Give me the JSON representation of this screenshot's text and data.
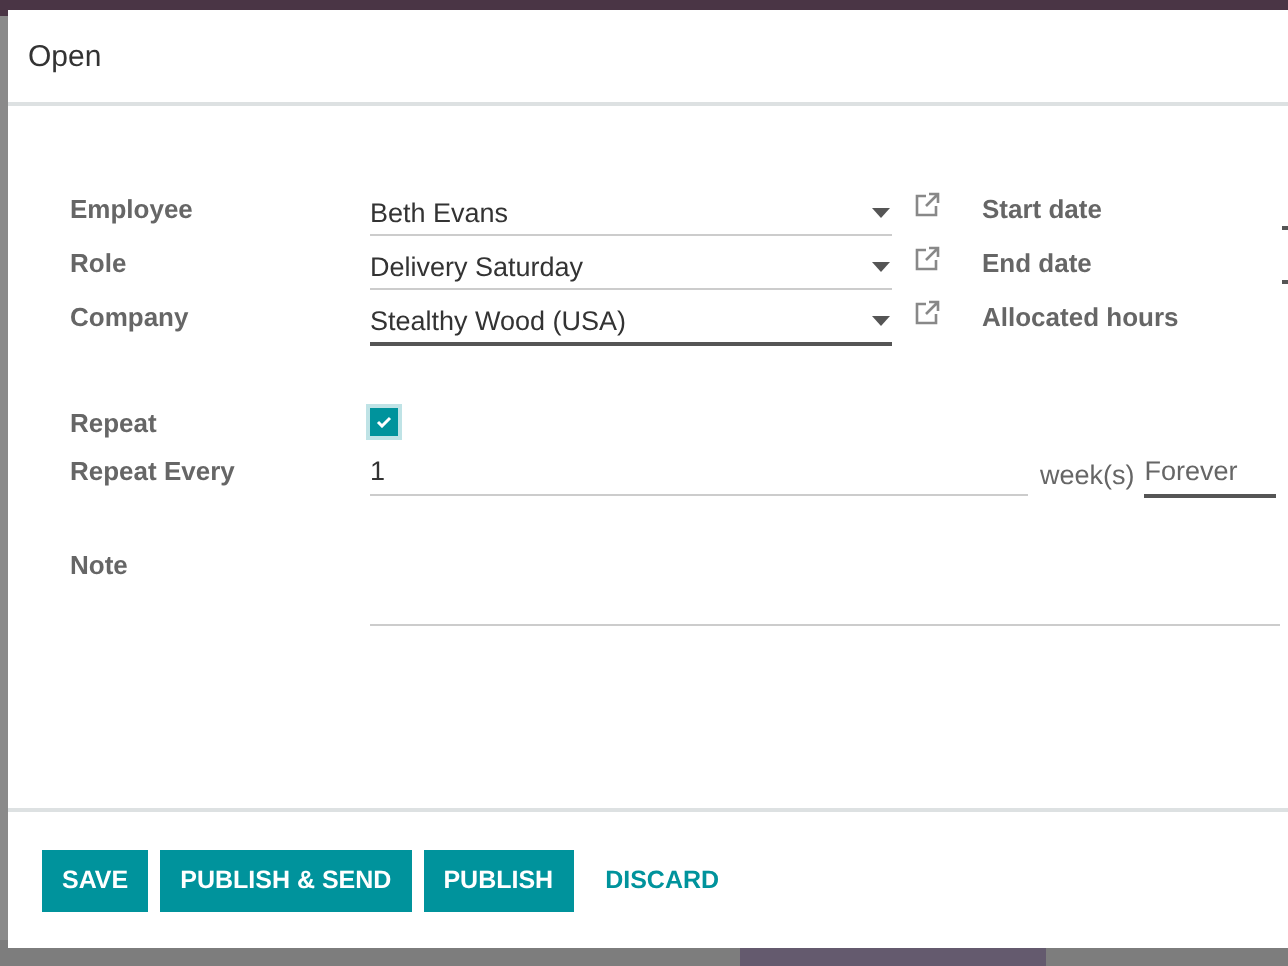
{
  "dialog": {
    "title": "Open"
  },
  "fields_left": [
    {
      "label": "Employee",
      "value": "Beth Evans",
      "focused": false
    },
    {
      "label": "Role",
      "value": "Delivery Saturday",
      "focused": false
    },
    {
      "label": "Company",
      "value": "Stealthy Wood (USA)",
      "focused": true
    }
  ],
  "fields_right": [
    {
      "label": "Start date"
    },
    {
      "label": "End date"
    },
    {
      "label": "Allocated hours"
    }
  ],
  "repeat": {
    "label": "Repeat",
    "checked": true
  },
  "repeat_every": {
    "label": "Repeat Every",
    "value": "1",
    "unit": "week(s)",
    "until": "Forever"
  },
  "note": {
    "label": "Note"
  },
  "buttons": [
    {
      "label": "SAVE",
      "kind": "primary"
    },
    {
      "label": "PUBLISH & SEND",
      "kind": "primary"
    },
    {
      "label": "PUBLISH",
      "kind": "primary"
    },
    {
      "label": "DISCARD",
      "kind": "link"
    }
  ]
}
